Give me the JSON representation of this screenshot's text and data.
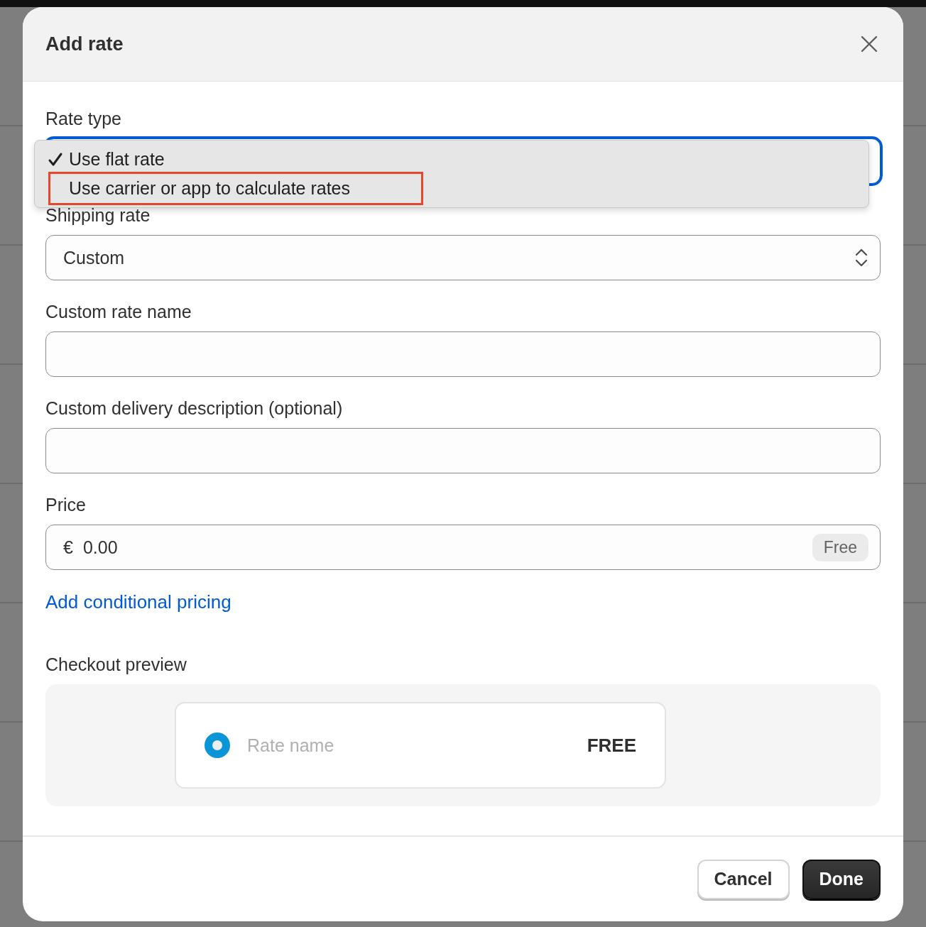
{
  "dialog": {
    "title": "Add rate"
  },
  "fields": [
    {
      "kind": "select",
      "label": "Rate type",
      "focused": true
    },
    {
      "kind": "select",
      "label": "Shipping rate",
      "value": "Custom",
      "focused": false
    },
    {
      "kind": "text",
      "label": "Custom rate name",
      "focused": false
    },
    {
      "kind": "text",
      "label": "Custom delivery description (optional)",
      "focused": false
    },
    {
      "kind": "price",
      "label": "Price",
      "prefix": "€",
      "value": "0.00",
      "badge": "Free",
      "focused": false
    }
  ],
  "dropdown": {
    "options": [
      {
        "label": "Use flat rate",
        "selected": true,
        "outlined": false
      },
      {
        "label": "Use carrier or app to calculate rates",
        "selected": false,
        "outlined": true
      }
    ]
  },
  "link": "Add conditional pricing",
  "checkout_preview": {
    "label": "Checkout preview",
    "option": {
      "name": "Rate name",
      "price": "FREE",
      "selected": true
    }
  },
  "buttons": [
    {
      "label": "Cancel",
      "kind": "secondary"
    },
    {
      "label": "Done",
      "kind": "primary"
    }
  ]
}
